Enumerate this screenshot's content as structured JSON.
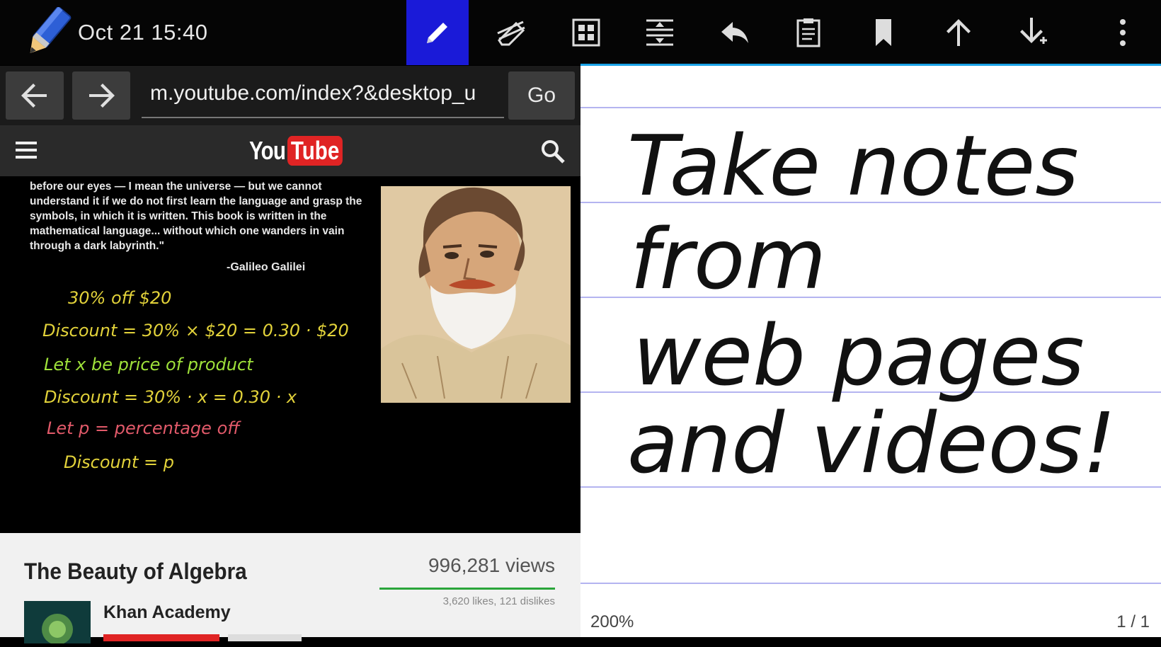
{
  "status": {
    "clock": "Oct 21 15:40"
  },
  "toolbar": {
    "tools": [
      {
        "name": "pen-tool",
        "icon": "pencil-icon",
        "active": true
      },
      {
        "name": "eraser-tool",
        "icon": "eraser-icon"
      },
      {
        "name": "grid-tool",
        "icon": "grid-icon"
      },
      {
        "name": "insert-space-tool",
        "icon": "insert-space-icon"
      },
      {
        "name": "undo-tool",
        "icon": "undo-icon"
      },
      {
        "name": "clipboard-tool",
        "icon": "clipboard-icon"
      },
      {
        "name": "bookmark-tool",
        "icon": "bookmark-icon"
      },
      {
        "name": "page-up-tool",
        "icon": "arrow-up-icon"
      },
      {
        "name": "page-add-tool",
        "icon": "arrow-down-plus-icon"
      },
      {
        "name": "overflow-menu",
        "icon": "more-vert-icon"
      }
    ],
    "accent_color": "#1aa3e8",
    "active_color": "#1a1ad8"
  },
  "browser": {
    "url": "m.youtube.com/index?&desktop_u",
    "go_label": "Go",
    "site": {
      "logo_you": "You",
      "logo_tube": "Tube",
      "logo_color": "#e02424"
    },
    "video": {
      "quote": "before our eyes — I mean the universe — but we cannot understand it if we do not first learn the language and grasp the symbols, in which it is written. This book is written in the mathematical language... without which one wanders in vain through a dark labyrinth.\"",
      "quote_author": "-Galileo Galilei",
      "math_lines": [
        {
          "text": "30% off     $20",
          "color": "#e2d23a"
        },
        {
          "text": "Discount = 30% × $20 = 0.30 · $20",
          "color": "#e2d23a"
        },
        {
          "text": "Let x be price of product",
          "color": "#9fe23a"
        },
        {
          "text": "Discount = 30% · x = 0.30 · x",
          "color": "#e2d23a"
        },
        {
          "text": "Let p = percentage off",
          "color": "#e25a6a"
        },
        {
          "text": "Discount = p",
          "color": "#e2d23a"
        }
      ]
    },
    "info": {
      "title": "The Beauty of Algebra",
      "views": "996,281 views",
      "likes": "3,620 likes, 121 dislikes",
      "channel": "Khan Academy"
    }
  },
  "note": {
    "handwriting_lines": [
      "Take notes",
      "from",
      "web pages",
      "and videos!"
    ],
    "zoom": "200%",
    "page": "1 / 1",
    "rule_color": "#b4b4f0"
  }
}
